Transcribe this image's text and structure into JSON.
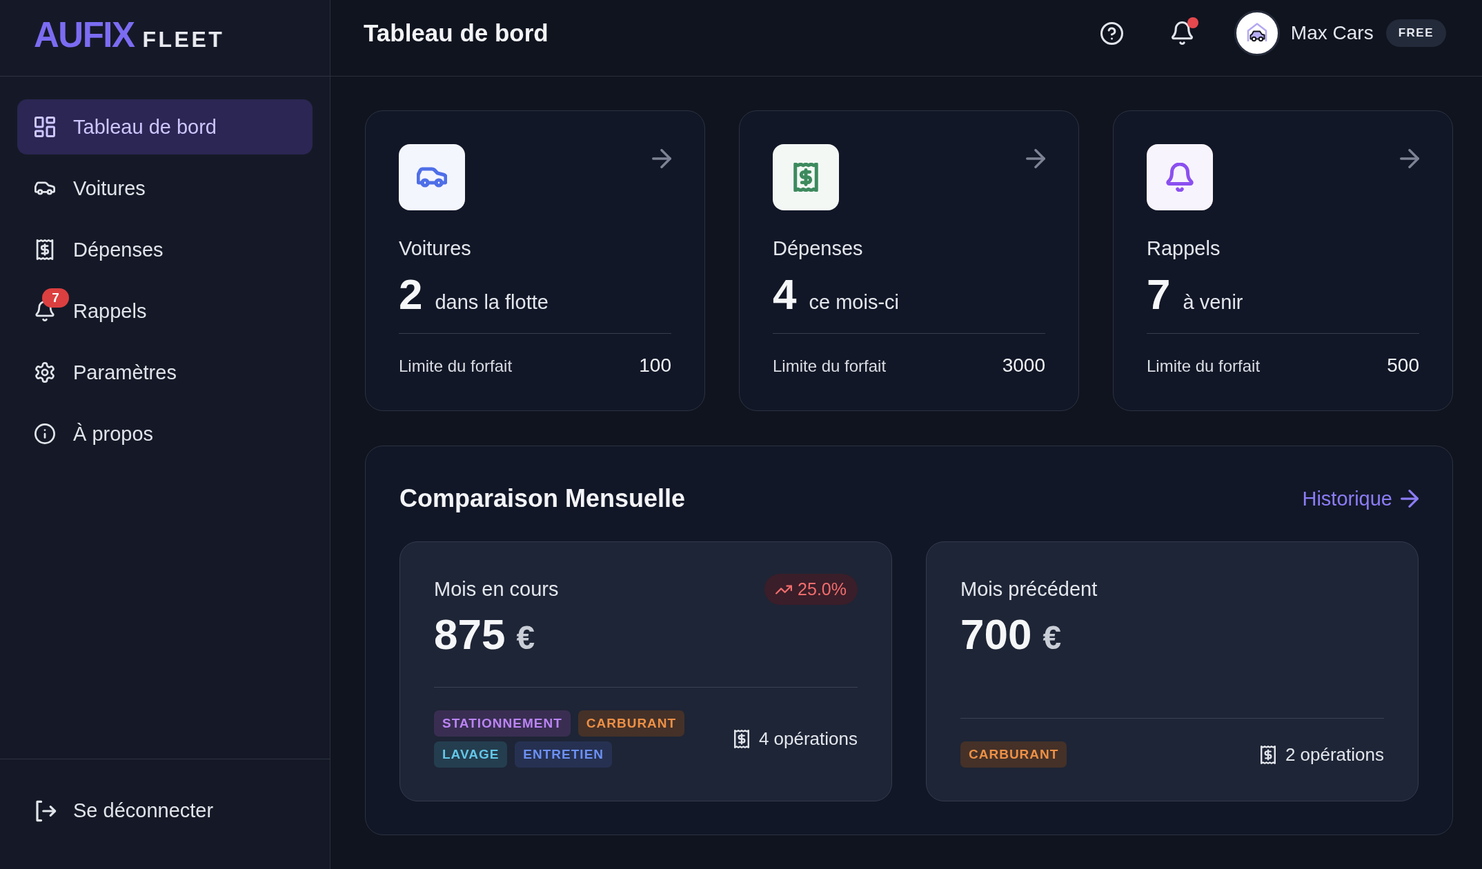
{
  "brand": {
    "name": "AUFIX",
    "suffix": "FLEET"
  },
  "sidebar": {
    "items": [
      {
        "label": "Tableau de bord",
        "selected": true
      },
      {
        "label": "Voitures",
        "selected": false
      },
      {
        "label": "Dépenses",
        "selected": false
      },
      {
        "label": "Rappels",
        "selected": false,
        "badge": "7"
      },
      {
        "label": "Paramètres",
        "selected": false
      },
      {
        "label": "À propos",
        "selected": false
      }
    ],
    "logout": {
      "label": "Se déconnecter"
    }
  },
  "header": {
    "title": "Tableau de bord",
    "notifications": {
      "unread": true
    },
    "user": {
      "name": "Max Cars",
      "plan": "FREE"
    }
  },
  "stat_cards": [
    {
      "title": "Voitures",
      "value": "2",
      "caption": "dans la flotte",
      "limit_label": "Limite du forfait",
      "limit": "100",
      "color": "#4f6fe8"
    },
    {
      "title": "Dépenses",
      "value": "4",
      "caption": "ce mois-ci",
      "limit_label": "Limite du forfait",
      "limit": "3000",
      "color": "#3d8a5e"
    },
    {
      "title": "Rappels",
      "value": "7",
      "caption": "à venir",
      "limit_label": "Limite du forfait",
      "limit": "500",
      "color": "#8b4ff0"
    }
  ],
  "comparison": {
    "title": "Comparaison Mensuelle",
    "link": "Historique",
    "months": [
      {
        "label": "Mois en cours",
        "amount": "875",
        "currency": "€",
        "change": {
          "increase": true,
          "value": "25.0%"
        },
        "tags": [
          {
            "label": "STATIONNEMENT",
            "color": "#392e52"
          },
          {
            "label": "CARBURANT",
            "color": "#453128"
          },
          {
            "label": "LAVAGE",
            "color": "#243e4f"
          },
          {
            "label": "ENTRETIEN",
            "color": "#263152"
          }
        ],
        "operations": "4 opérations"
      },
      {
        "label": "Mois précédent",
        "amount": "700",
        "currency": "€",
        "tags": [
          {
            "label": "CARBURANT",
            "color": "#453128"
          }
        ],
        "operations": "2 opérations"
      }
    ]
  }
}
